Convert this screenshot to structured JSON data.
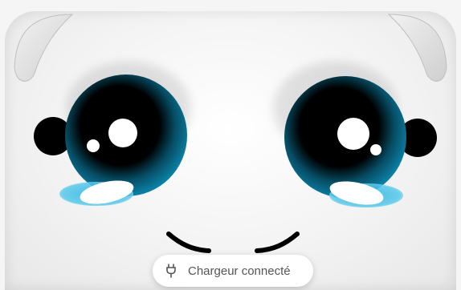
{
  "notification": {
    "icon": "plug-icon",
    "text": "Chargeur connecté"
  },
  "character": {
    "eye_color": "#0b7fa3",
    "pupil_color": "#000000",
    "skin_color": "#f4f4f4",
    "tear_color": "#27b7e0"
  }
}
